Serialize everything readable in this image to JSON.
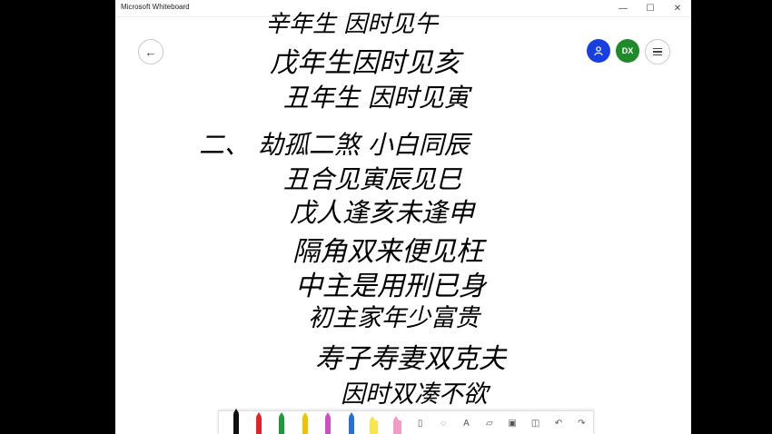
{
  "window": {
    "title": "Microsoft Whiteboard"
  },
  "title_controls": {
    "minimize": "—",
    "maximize": "☐",
    "close": "✕"
  },
  "header": {
    "avatar_initials": "DX"
  },
  "ink_lines": [
    "辛年生 因时见午",
    "戊年生因时见亥",
    "丑年生 因时见寅",
    "二、 劫孤二煞 小白同辰",
    "丑合见寅辰见巳",
    "戊人逢亥未逢申",
    "隔角双来便见枉",
    "中主是用刑已身",
    "初主家年少富贵",
    "寿子寿妻双克夫",
    "因时双凑不欲"
  ],
  "toolbar": {
    "tools": [
      {
        "name": "pen-black",
        "color": "#111111"
      },
      {
        "name": "pen-red",
        "color": "#e0222a"
      },
      {
        "name": "pen-green",
        "color": "#1a9a3a"
      },
      {
        "name": "pen-yellow",
        "color": "#f2c200"
      },
      {
        "name": "pen-multicolor",
        "color": "#d04fc0"
      },
      {
        "name": "pen-blue",
        "color": "#2a6fd8"
      },
      {
        "name": "highlighter-yellow",
        "color": "#f5e84a"
      },
      {
        "name": "highlighter-pink",
        "color": "#f39ac6"
      }
    ],
    "icons": [
      "ruler-icon",
      "lasso-icon",
      "text-icon",
      "sticky-note-icon",
      "image-icon",
      "shapes-icon",
      "undo-icon",
      "redo-icon"
    ]
  }
}
